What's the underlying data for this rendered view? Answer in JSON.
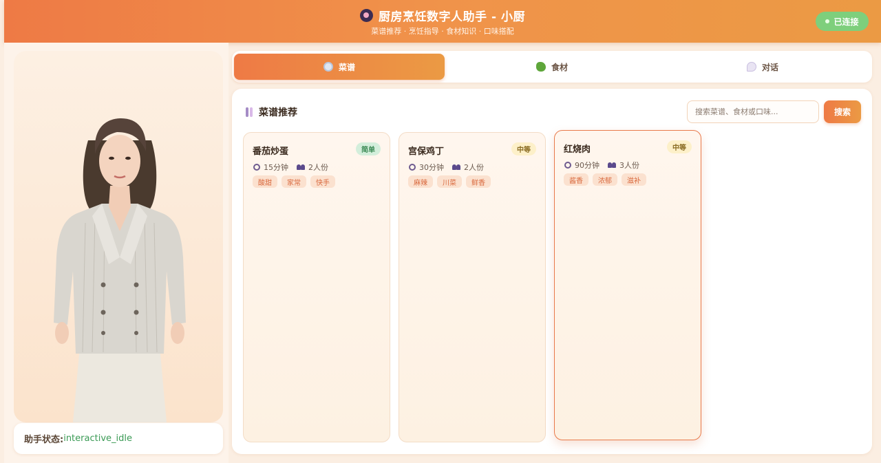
{
  "header": {
    "title": "厨房烹饪数字人助手 - 小厨",
    "subtitle": "菜谱推荐 · 烹饪指导 · 食材知识 · 口味搭配",
    "connection_status": "已连接",
    "logo_icon": "chef-logo-icon"
  },
  "assistant": {
    "status_label": "助手状态:",
    "status_value": "interactive_idle"
  },
  "tabs": [
    {
      "label": "菜谱",
      "icon": "plate-icon",
      "active": true
    },
    {
      "label": "食材",
      "icon": "vegetable-icon",
      "active": false
    },
    {
      "label": "对话",
      "icon": "chat-bubble-icon",
      "active": false
    }
  ],
  "recipes_section": {
    "title": "菜谱推荐",
    "search_placeholder": "搜索菜谱、食材或口味...",
    "search_button": "搜索"
  },
  "recipes": [
    {
      "name": "番茄炒蛋",
      "difficulty": "简单",
      "time": "15分钟",
      "servings": "2人份",
      "tags": [
        "酸甜",
        "家常",
        "快手"
      ]
    },
    {
      "name": "宫保鸡丁",
      "difficulty": "中等",
      "time": "30分钟",
      "servings": "2人份",
      "tags": [
        "麻辣",
        "川菜",
        "鲜香"
      ]
    },
    {
      "name": "红烧肉",
      "difficulty": "中等",
      "time": "90分钟",
      "servings": "3人份",
      "tags": [
        "酱香",
        "浓郁",
        "滋补"
      ]
    }
  ],
  "colors": {
    "accent": "#ee7a45",
    "accent_end": "#eb9a44",
    "status_green": "#7ecf7c",
    "easy_badge": "#d3eedb",
    "medium_badge": "#fdf0c9",
    "tag_bg": "#fbe1cf",
    "tag_text": "#d9693e"
  }
}
